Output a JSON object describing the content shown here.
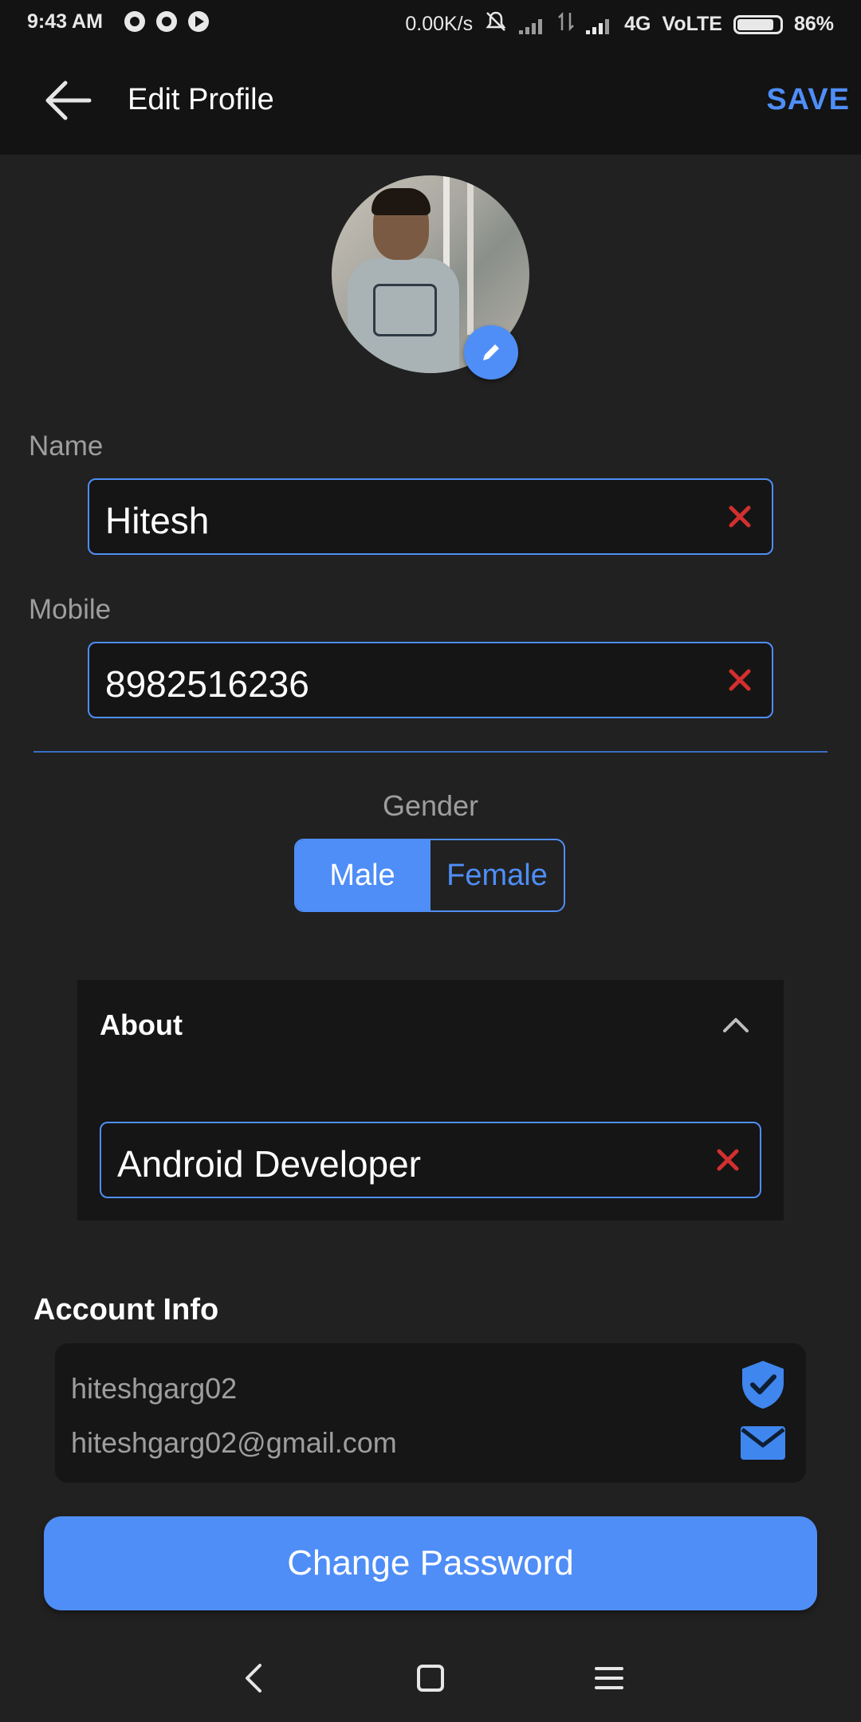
{
  "status_bar": {
    "time": "9:43 AM",
    "network_speed": "0.00K/s",
    "network_type": "4G",
    "volte": "VoLTE",
    "battery": "86%",
    "icons": [
      "whatsapp-icon",
      "whatsapp-icon",
      "play-store-icon",
      "silent-icon",
      "signal-icon",
      "battery-icon"
    ]
  },
  "app_bar": {
    "title": "Edit Profile",
    "save_label": "SAVE",
    "back_icon": "arrow-back-icon"
  },
  "profile": {
    "name_label": "Name",
    "name_value": "Hitesh",
    "mobile_label": "Mobile",
    "mobile_value": "8982516236",
    "gender_label": "Gender",
    "gender_options": [
      "Male",
      "Female"
    ],
    "gender_selected": "Male"
  },
  "about": {
    "heading": "About",
    "value": "Android Developer"
  },
  "account_info": {
    "title": "Account Info",
    "username": "hiteshgarg02",
    "email": "hiteshgarg02@gmail.com"
  },
  "change_password_label": "Change Password",
  "colors": {
    "accent": "#4f8ef7",
    "background": "#212121",
    "app_bar": "#131313",
    "clear_icon": "#d32f2f"
  }
}
